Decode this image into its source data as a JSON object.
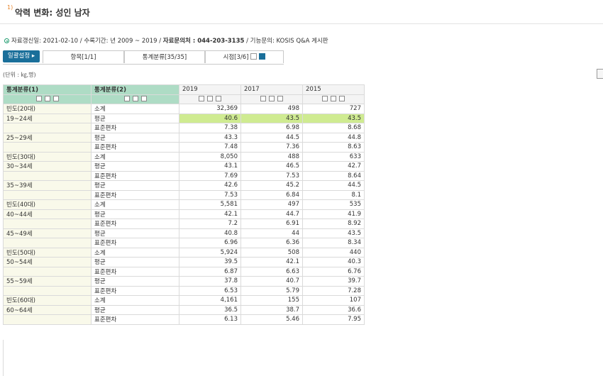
{
  "title": {
    "superscript": "1)",
    "text": "악력 변화: 성인 남자"
  },
  "info": {
    "updated": "자료갱신일: 2021-02-10",
    "period": " / 수록기간: 년 2009 ~ 2019 / ",
    "contact_label": "자료문의처 : 044-203-3135",
    "func": " / 기능문의: KOSIS Q&A 게시판"
  },
  "toolbar": {
    "bulk_label": "일괄설정 ▸",
    "tab_items": "항목[1/1]",
    "tab_class": "통계분류[35/35]",
    "tab_time": "시점[3/6]"
  },
  "unit_label": "(단위 : ㎏,명)",
  "table": {
    "headers": [
      "통계분류(1)",
      "통계분류(2)",
      "2019",
      "2017",
      "2015"
    ],
    "rows": [
      [
        "빈도(20대)",
        "소계",
        "32,369",
        "498",
        "727"
      ],
      [
        "19~24세",
        "평균",
        "40.6",
        "43.5",
        "43.5"
      ],
      [
        "",
        "표준편차",
        "7.38",
        "6.98",
        "8.68"
      ],
      [
        "25~29세",
        "평균",
        "43.3",
        "44.5",
        "44.8"
      ],
      [
        "",
        "표준편차",
        "7.48",
        "7.36",
        "8.63"
      ],
      [
        "빈도(30대)",
        "소계",
        "8,050",
        "488",
        "633"
      ],
      [
        "30~34세",
        "평균",
        "43.1",
        "46.5",
        "42.7"
      ],
      [
        "",
        "표준편차",
        "7.69",
        "7.53",
        "8.64"
      ],
      [
        "35~39세",
        "평균",
        "42.6",
        "45.2",
        "44.5"
      ],
      [
        "",
        "표준편차",
        "7.53",
        "6.84",
        "8.1"
      ],
      [
        "빈도(40대)",
        "소계",
        "5,581",
        "497",
        "535"
      ],
      [
        "40~44세",
        "평균",
        "42.1",
        "44.7",
        "41.9"
      ],
      [
        "",
        "표준편차",
        "7.2",
        "6.91",
        "8.92"
      ],
      [
        "45~49세",
        "평균",
        "40.8",
        "44",
        "43.5"
      ],
      [
        "",
        "표준편차",
        "6.96",
        "6.36",
        "8.34"
      ],
      [
        "빈도(50대)",
        "소계",
        "5,924",
        "508",
        "440"
      ],
      [
        "50~54세",
        "평균",
        "39.5",
        "42.1",
        "40.3"
      ],
      [
        "",
        "표준편차",
        "6.87",
        "6.63",
        "6.76"
      ],
      [
        "55~59세",
        "평균",
        "37.8",
        "40.7",
        "39.7"
      ],
      [
        "",
        "표준편차",
        "6.53",
        "5.79",
        "7.28"
      ],
      [
        "빈도(60대)",
        "소계",
        "4,161",
        "155",
        "107"
      ],
      [
        "60~64세",
        "평균",
        "36.5",
        "38.7",
        "36.6"
      ],
      [
        "",
        "표준편차",
        "6.13",
        "5.46",
        "7.95"
      ]
    ],
    "highlight_row": 1
  },
  "colors": {
    "accent": "#1a6f9a",
    "header_green": "#aedcc5",
    "highlight": "#cfeb91",
    "dim_cell_bg": "#f9f9ea"
  }
}
